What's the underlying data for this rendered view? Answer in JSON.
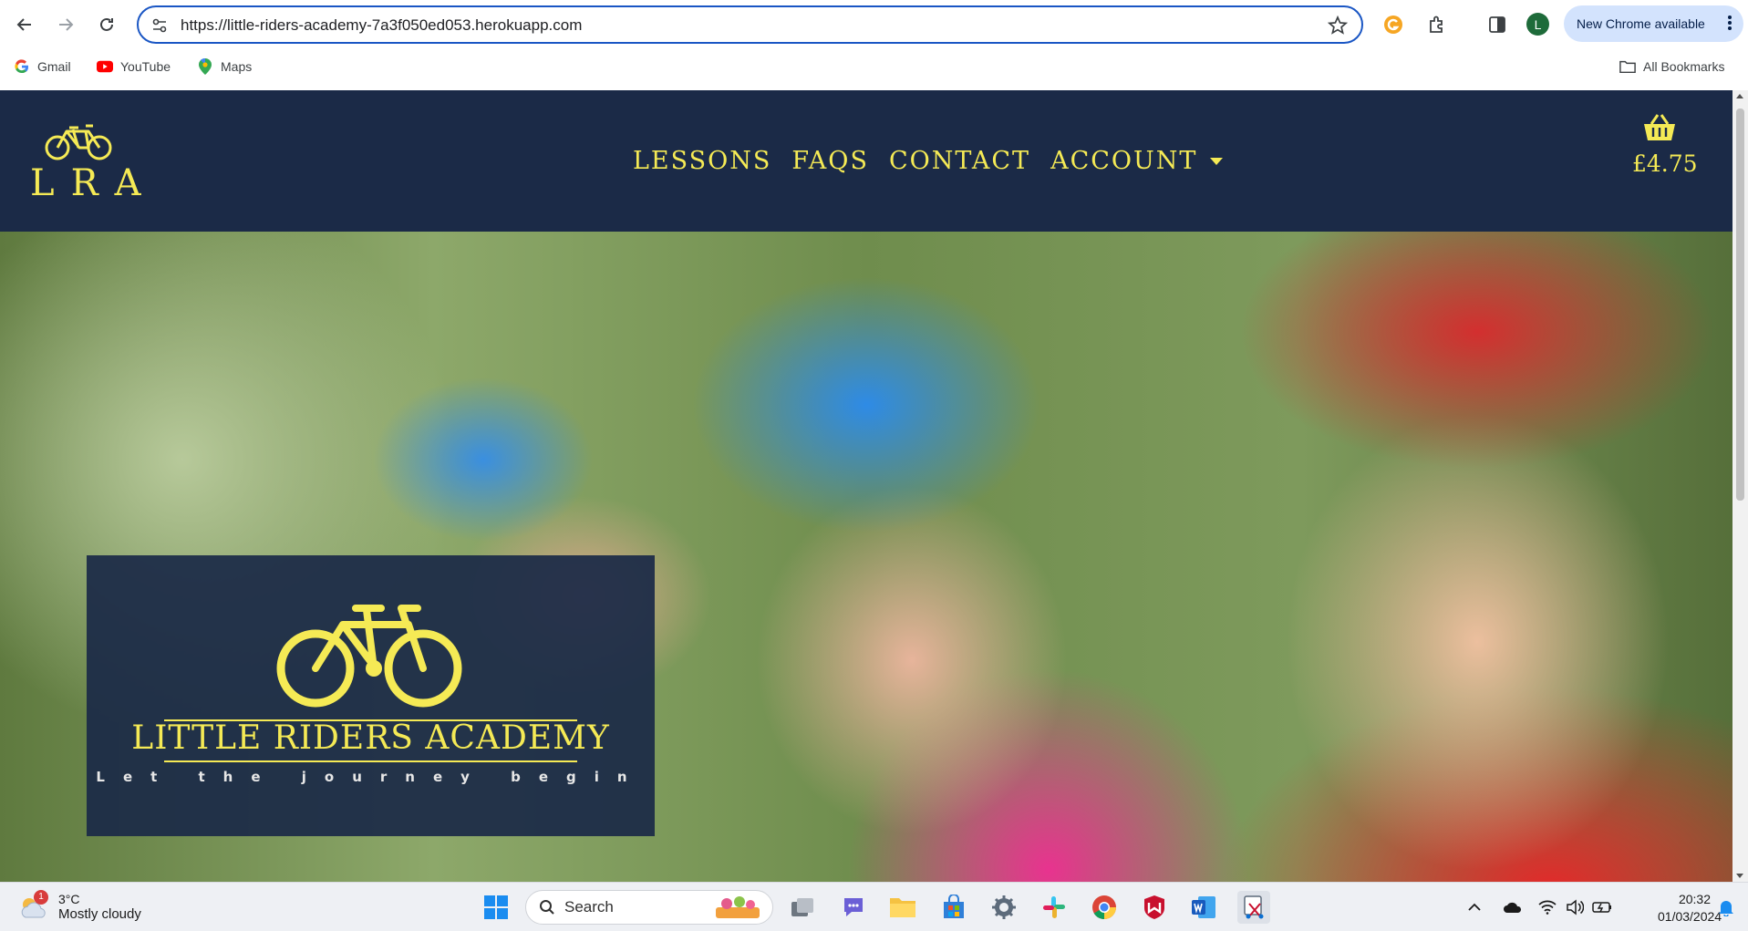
{
  "browser": {
    "url": "https://little-riders-academy-7a3f050ed053.herokuapp.com",
    "profile_initial": "L",
    "update_label": "New Chrome available",
    "bookmarks": [
      {
        "label": "Gmail",
        "icon": "google-icon"
      },
      {
        "label": "YouTube",
        "icon": "youtube-icon"
      },
      {
        "label": "Maps",
        "icon": "maps-icon"
      }
    ],
    "all_bookmarks_label": "All Bookmarks"
  },
  "site": {
    "logo_letters": "LRA",
    "nav": {
      "lessons": "LESSONS",
      "faqs": "FAQS",
      "contact": "CONTACT",
      "account": "ACCOUNT"
    },
    "basket_total": "£4.75",
    "hero": {
      "brand": "LITTLE RIDERS ACADEMY",
      "tagline": "Let the journey begin"
    },
    "colors": {
      "navy": "#1b2a47",
      "yellow": "#f5ea55"
    }
  },
  "taskbar": {
    "weather_temp": "3°C",
    "weather_condition": "Mostly cloudy",
    "weather_badge": "1",
    "search_label": "Search",
    "time": "20:32",
    "date": "01/03/2024"
  }
}
